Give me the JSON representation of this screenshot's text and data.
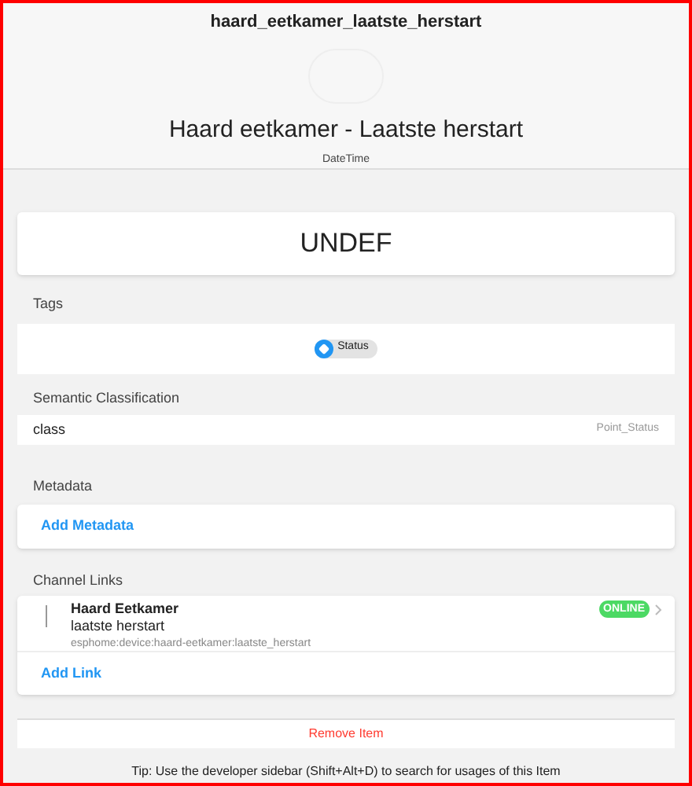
{
  "header": {
    "name": "haard_eetkamer_laatste_herstart",
    "label": "Haard eetkamer - Laatste herstart",
    "type": "DateTime"
  },
  "state": "UNDEF",
  "tags": {
    "title": "Tags",
    "items": [
      {
        "label": "Status"
      }
    ]
  },
  "semantic": {
    "title": "Semantic Classification",
    "key": "class",
    "value": "Point_Status"
  },
  "metadata": {
    "title": "Metadata",
    "add": "Add Metadata"
  },
  "channel_links": {
    "title": "Channel Links",
    "links": [
      {
        "thing": "Haard Eetkamer",
        "channel": "laatste herstart",
        "uid": "esphome:device:haard-eetkamer:laatste_herstart",
        "status": "ONLINE",
        "color": "#4cd964"
      }
    ],
    "add": "Add Link"
  },
  "remove": "Remove Item",
  "tip": "Tip: Use the developer sidebar (Shift+Alt+D) to search for usages of this Item"
}
